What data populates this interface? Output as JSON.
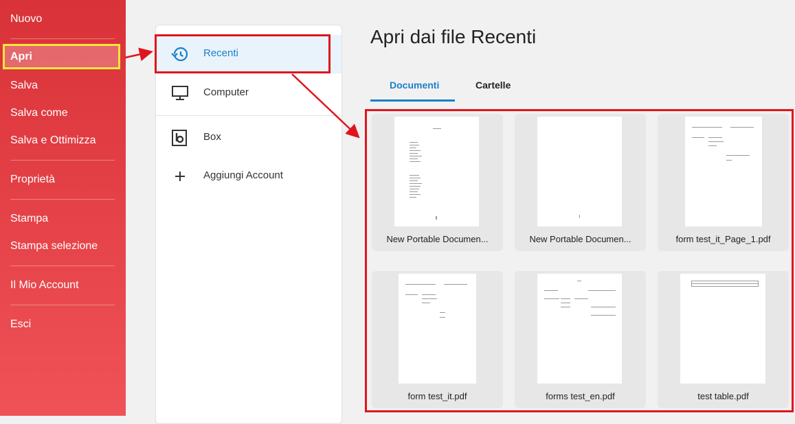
{
  "menu": {
    "items": [
      {
        "label": "Nuovo"
      },
      {
        "label": "Apri"
      },
      {
        "label": "Salva"
      },
      {
        "label": "Salva come"
      },
      {
        "label": "Salva e Ottimizza"
      },
      {
        "label": "Proprietà"
      },
      {
        "label": "Stampa"
      },
      {
        "label": "Stampa selezione"
      },
      {
        "label": "Il Mio Account"
      },
      {
        "label": "Esci"
      }
    ],
    "selected": "Apri"
  },
  "locations": {
    "items": [
      {
        "label": "Recenti",
        "icon": "history-icon"
      },
      {
        "label": "Computer",
        "icon": "monitor-icon"
      },
      {
        "label": "Box",
        "icon": "box-icon"
      },
      {
        "label": "Aggiungi Account",
        "icon": "plus-icon"
      }
    ],
    "selected": "Recenti"
  },
  "main": {
    "title": "Apri dai file Recenti",
    "tabs": [
      {
        "label": "Documenti",
        "active": true
      },
      {
        "label": "Cartelle",
        "active": false
      }
    ],
    "files": [
      {
        "name": "New Portable Documen..."
      },
      {
        "name": "New Portable Documen..."
      },
      {
        "name": "form test_it_Page_1.pdf"
      },
      {
        "name": "form test_it.pdf"
      },
      {
        "name": "forms test_en.pdf"
      },
      {
        "name": "test table.pdf"
      }
    ]
  },
  "colors": {
    "menu_top": "#d93238",
    "menu_bottom": "#ef5257",
    "accent": "#1a7fc9",
    "annotation_red": "#e0141c",
    "annotation_yellow": "#f5e73b"
  }
}
